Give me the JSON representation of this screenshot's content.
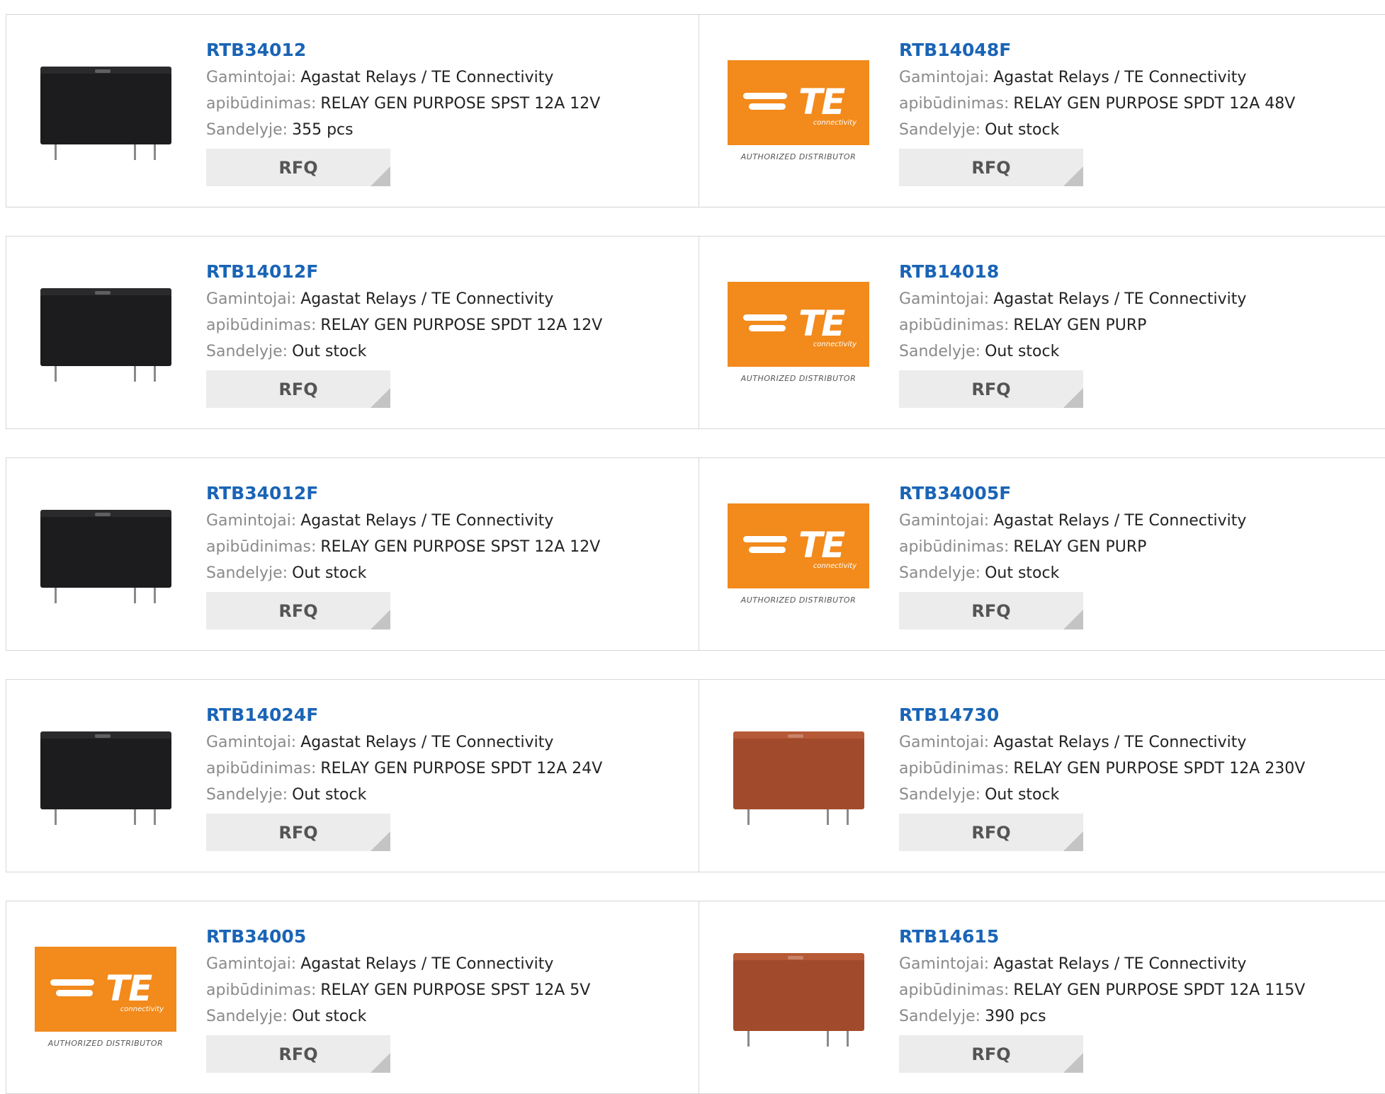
{
  "labels": {
    "manufacturer": "Gamintojai:",
    "description": "apibūdinimas:",
    "stock": "Sandelyje:",
    "rfq": "RFQ",
    "te_text": "TE",
    "te_sub": "connectivity",
    "authorized": "AUTHORIZED DISTRIBUTOR"
  },
  "colors": {
    "accent_link": "#1a64b6",
    "te_orange": "#f28a1c"
  },
  "products": [
    {
      "name": "RTB34012",
      "manufacturer": "Agastat Relays / TE Connectivity",
      "description": "RELAY GEN PURPOSE SPST 12A 12V",
      "stock": "355 pcs",
      "image": "relay-black"
    },
    {
      "name": "RTB14048F",
      "manufacturer": "Agastat Relays / TE Connectivity",
      "description": "RELAY GEN PURPOSE SPDT 12A 48V",
      "stock": "Out stock",
      "image": "te-logo"
    },
    {
      "name": "RTB14012F",
      "manufacturer": "Agastat Relays / TE Connectivity",
      "description": "RELAY GEN PURPOSE SPDT 12A 12V",
      "stock": "Out stock",
      "image": "relay-black"
    },
    {
      "name": "RTB14018",
      "manufacturer": "Agastat Relays / TE Connectivity",
      "description": "RELAY GEN PURP",
      "stock": "Out stock",
      "image": "te-logo"
    },
    {
      "name": "RTB34012F",
      "manufacturer": "Agastat Relays / TE Connectivity",
      "description": "RELAY GEN PURPOSE SPST 12A 12V",
      "stock": "Out stock",
      "image": "relay-black"
    },
    {
      "name": "RTB34005F",
      "manufacturer": "Agastat Relays / TE Connectivity",
      "description": "RELAY GEN PURP",
      "stock": "Out stock",
      "image": "te-logo"
    },
    {
      "name": "RTB14024F",
      "manufacturer": "Agastat Relays / TE Connectivity",
      "description": "RELAY GEN PURPOSE SPDT 12A 24V",
      "stock": "Out stock",
      "image": "relay-black"
    },
    {
      "name": "RTB14730",
      "manufacturer": "Agastat Relays / TE Connectivity",
      "description": "RELAY GEN PURPOSE SPDT 12A 230V",
      "stock": "Out stock",
      "image": "relay-brown"
    },
    {
      "name": "RTB34005",
      "manufacturer": "Agastat Relays / TE Connectivity",
      "description": "RELAY GEN PURPOSE SPST 12A 5V",
      "stock": "Out stock",
      "image": "te-logo"
    },
    {
      "name": "RTB14615",
      "manufacturer": "Agastat Relays / TE Connectivity",
      "description": "RELAY GEN PURPOSE SPDT 12A 115V",
      "stock": "390 pcs",
      "image": "relay-brown"
    }
  ]
}
